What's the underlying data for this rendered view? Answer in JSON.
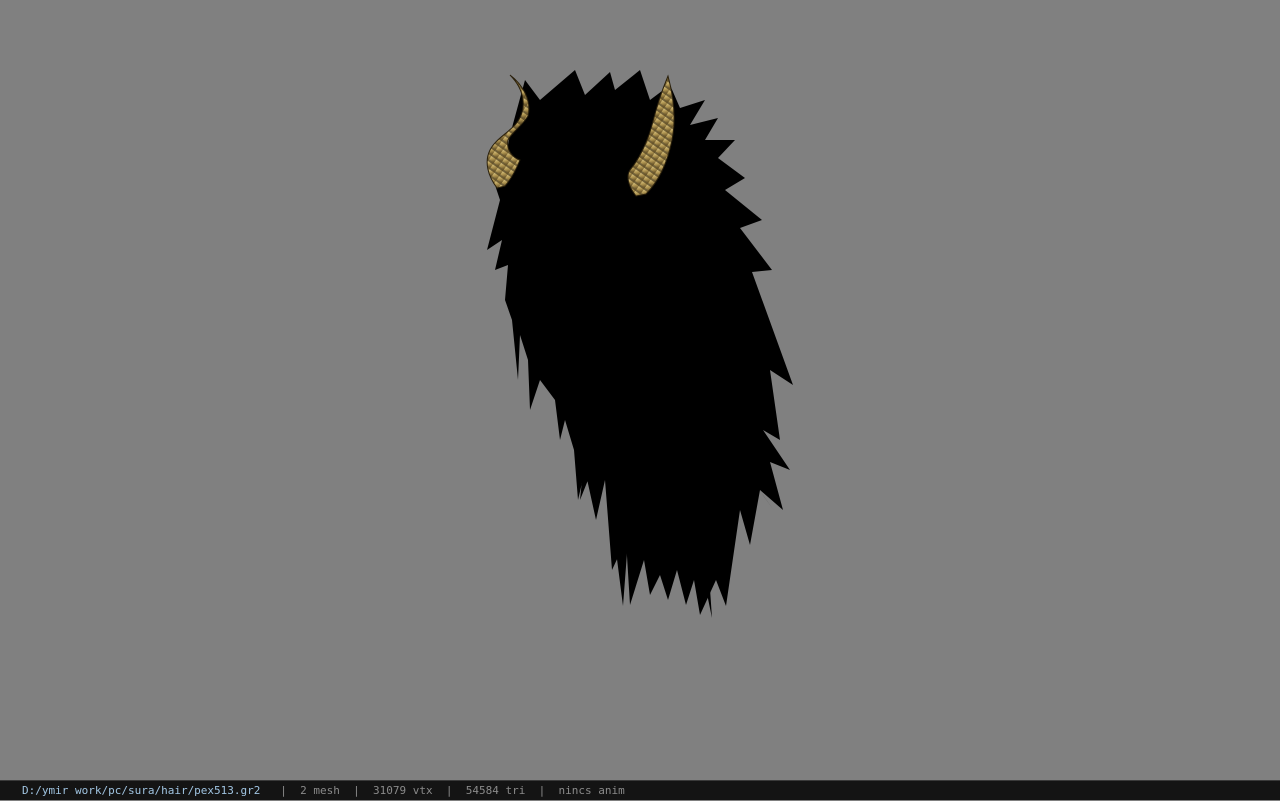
{
  "viewer": {
    "background_color": "#808080",
    "model": {
      "description_icon": "hair-model-icon",
      "hair_color": "#000000",
      "horn_color": "#b59a55"
    }
  },
  "status_bar": {
    "file_path": "D:/ymir work/pc/sura/hair/pex513.gr2",
    "separator": "|",
    "mesh": "2 mesh",
    "vertices": "31079 vtx",
    "triangles": "54584 tri",
    "anim": "nincs anim"
  }
}
